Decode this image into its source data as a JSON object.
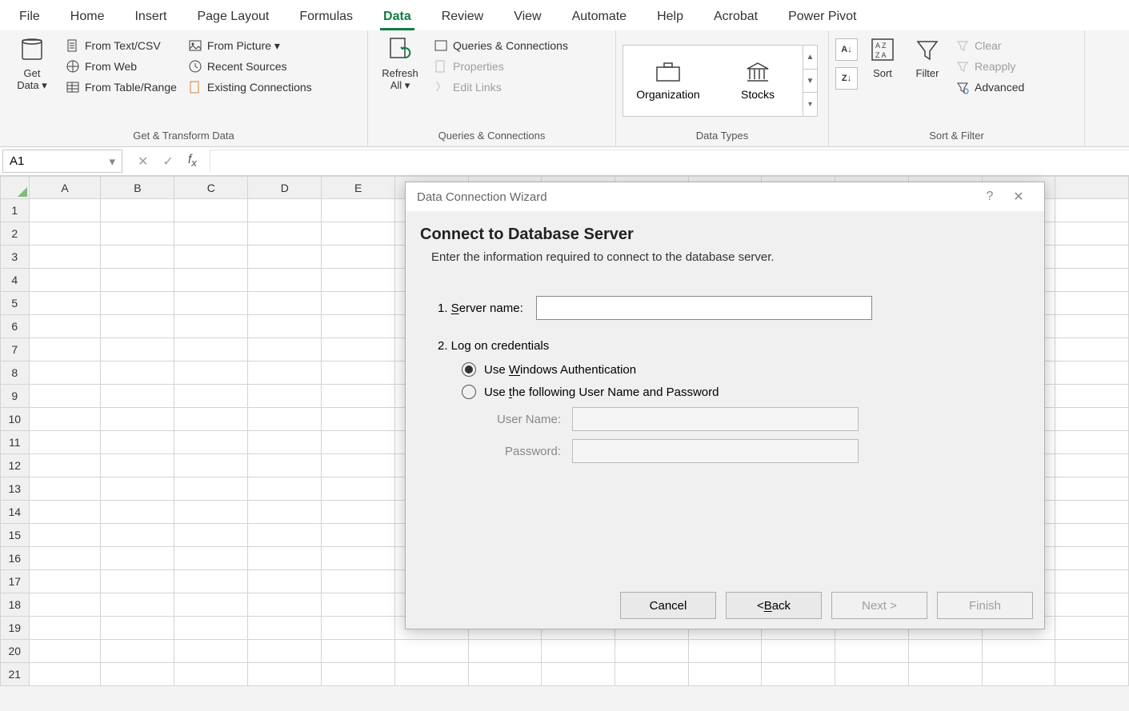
{
  "tabs": [
    "File",
    "Home",
    "Insert",
    "Page Layout",
    "Formulas",
    "Data",
    "Review",
    "View",
    "Automate",
    "Help",
    "Acrobat",
    "Power Pivot"
  ],
  "activeTab": "Data",
  "ribbon": {
    "getData": {
      "label": "Get\nData ▾"
    },
    "fromTextCsv": "From Text/CSV",
    "fromWeb": "From Web",
    "fromTableRange": "From Table/Range",
    "fromPicture": "From Picture ▾",
    "recentSources": "Recent Sources",
    "existingConnections": "Existing Connections",
    "groupTransform": "Get & Transform Data",
    "refreshAll": "Refresh\nAll ▾",
    "queriesConnections": "Queries & Connections",
    "properties": "Properties",
    "editLinks": "Edit Links",
    "groupQC": "Queries & Connections",
    "organization": "Organization",
    "stocks": "Stocks",
    "groupDataTypes": "Data Types",
    "sort": "Sort",
    "filter": "Filter",
    "clear": "Clear",
    "reapply": "Reapply",
    "advanced": "Advanced",
    "groupSortFilter": "Sort & Filter"
  },
  "namebox": "A1",
  "columns": [
    "A",
    "B",
    "C",
    "D",
    "E",
    "",
    "",
    "",
    "",
    "",
    "",
    "",
    "",
    "",
    ""
  ],
  "rows": [
    "1",
    "2",
    "3",
    "4",
    "5",
    "6",
    "7",
    "8",
    "9",
    "10",
    "11",
    "12",
    "13",
    "14",
    "15",
    "16",
    "17",
    "18",
    "19",
    "20",
    "21"
  ],
  "dialog": {
    "title": "Data Connection Wizard",
    "heading": "Connect to Database Server",
    "subheading": "Enter the information required to connect to the database server.",
    "serverLabelPrefix": "1. ",
    "serverLabelU": "S",
    "serverLabelRest": "erver name:",
    "credSection": "2. Log on credentials",
    "radioWinPrefix": "Use ",
    "radioWinU": "W",
    "radioWinRest": "indows Authentication",
    "radioUserPrefix": "Use ",
    "radioUserU": "t",
    "radioUserRest": "he following User Name and Password",
    "userName": "User Name:",
    "password": "Password:",
    "cancel": "Cancel",
    "backPrefix": "< ",
    "backU": "B",
    "backRest": "ack",
    "next": "Next >",
    "finish": "Finish"
  }
}
